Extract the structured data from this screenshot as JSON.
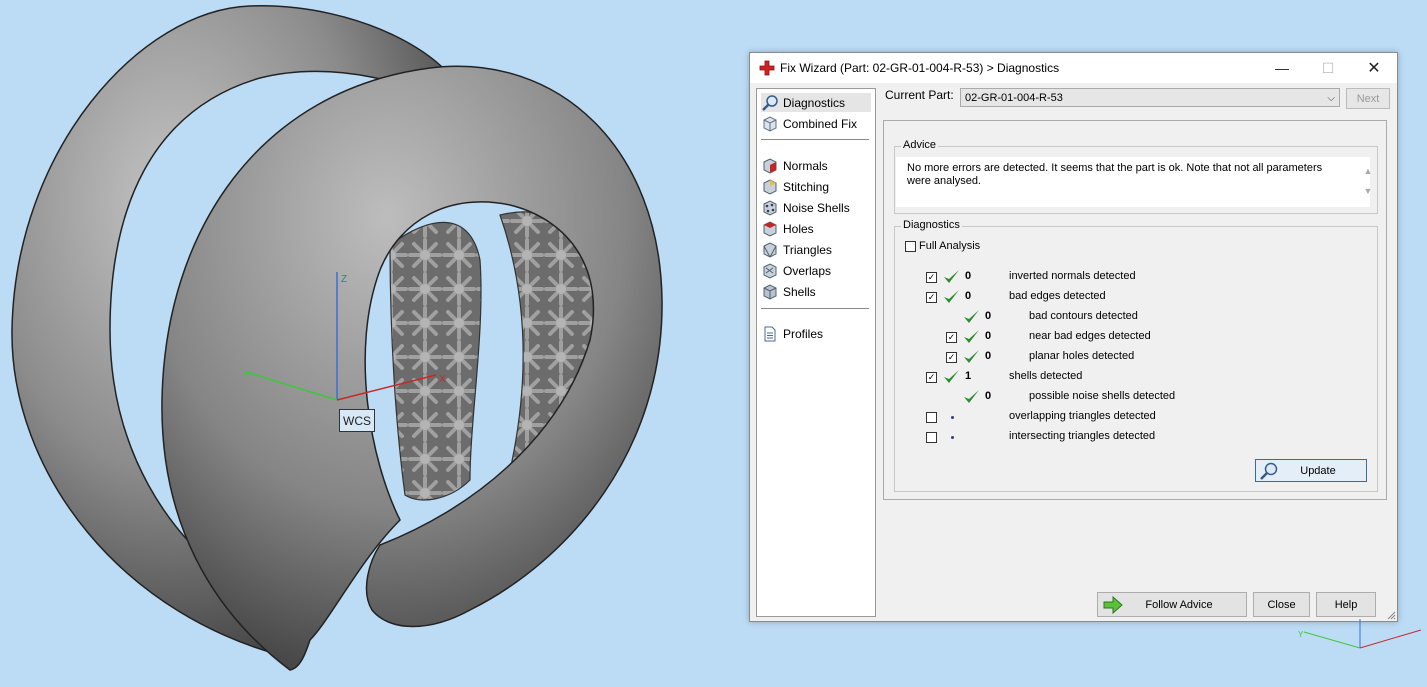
{
  "viewport": {
    "wcs_label": "WCS",
    "axes": {
      "x": "X",
      "y": "Y",
      "z": "Z"
    }
  },
  "window": {
    "title": "Fix Wizard (Part: 02-GR-01-004-R-53) > Diagnostics",
    "controls": {
      "minimize": "—",
      "maximize": "☐",
      "close": "✕"
    }
  },
  "sidebar": {
    "items": [
      {
        "label": "Diagnostics",
        "icon": "magnifier-icon",
        "selected": true
      },
      {
        "label": "Combined Fix",
        "icon": "cube-icon"
      },
      {
        "label": "Normals",
        "icon": "normals-cube-icon"
      },
      {
        "label": "Stitching",
        "icon": "stitching-cube-icon"
      },
      {
        "label": "Noise Shells",
        "icon": "noise-shells-icon"
      },
      {
        "label": "Holes",
        "icon": "holes-cube-icon"
      },
      {
        "label": "Triangles",
        "icon": "triangles-cube-icon"
      },
      {
        "label": "Overlaps",
        "icon": "overlaps-cube-icon"
      },
      {
        "label": "Shells",
        "icon": "shells-cube-icon"
      },
      {
        "label": "Profiles",
        "icon": "document-icon"
      }
    ]
  },
  "current_part": {
    "label": "Current Part:",
    "value": "02-GR-01-004-R-53",
    "next_label": "Next"
  },
  "advice": {
    "title": "Advice",
    "text": "No more errors are detected. It seems that the part is ok. Note that not all parameters were analysed."
  },
  "diagnostics": {
    "title": "Diagnostics",
    "full_analysis_label": "Full Analysis",
    "full_analysis_checked": false,
    "rows": [
      {
        "checkbox": true,
        "checked": true,
        "status": "ok",
        "count": "0",
        "label": "inverted normals detected",
        "indent": false
      },
      {
        "checkbox": true,
        "checked": true,
        "status": "ok",
        "count": "0",
        "label": "bad edges detected",
        "indent": false
      },
      {
        "checkbox": false,
        "checked": false,
        "status": "ok",
        "count": "0",
        "label": "bad contours detected",
        "indent": true
      },
      {
        "checkbox": true,
        "checked": true,
        "status": "ok",
        "count": "0",
        "label": "near bad edges detected",
        "indent": true
      },
      {
        "checkbox": true,
        "checked": true,
        "status": "ok",
        "count": "0",
        "label": "planar holes detected",
        "indent": true
      },
      {
        "checkbox": true,
        "checked": true,
        "status": "ok",
        "count": "1",
        "label": "shells detected",
        "indent": false
      },
      {
        "checkbox": false,
        "checked": false,
        "status": "ok",
        "count": "0",
        "label": "possible noise shells detected",
        "indent": true
      },
      {
        "checkbox": true,
        "checked": false,
        "status": "none",
        "count": "",
        "label": "overlapping triangles detected",
        "indent": false
      },
      {
        "checkbox": true,
        "checked": false,
        "status": "none",
        "count": "",
        "label": "intersecting triangles detected",
        "indent": false
      }
    ],
    "update_label": "Update"
  },
  "footer": {
    "follow_advice_label": "Follow Advice",
    "close_label": "Close",
    "help_label": "Help"
  },
  "colors": {
    "background": "#bcdcf6",
    "check_green": "#2e8b2e",
    "axis_x": "#c82828",
    "axis_y": "#3cc83c",
    "axis_z": "#3c6ed2"
  }
}
